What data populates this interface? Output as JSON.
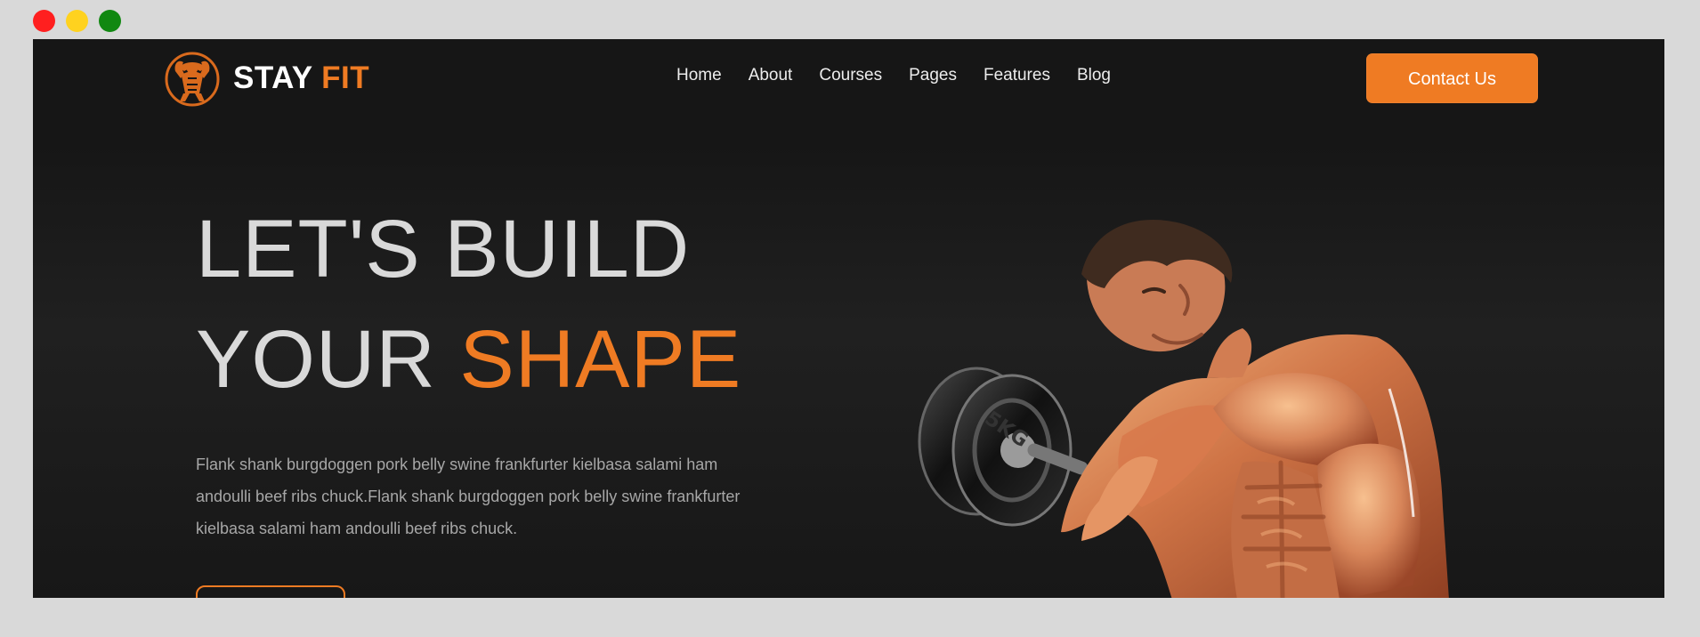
{
  "window_controls": {
    "red": "#ff1f1f",
    "yellow": "#ffd21f",
    "green": "#118811"
  },
  "brand": {
    "name_primary": "STAY",
    "name_accent": "FIT",
    "logo_icon": "bodybuilder-logo-icon",
    "accent_color": "#ef7b23"
  },
  "nav": {
    "items": [
      "Home",
      "About",
      "Courses",
      "Pages",
      "Features",
      "Blog"
    ],
    "cta_label": "Contact Us"
  },
  "hero": {
    "line_1": "LET'S BUILD",
    "line_2_prefix": "YOUR",
    "line_2_accent": "SHAPE",
    "description": "Flank shank burgdoggen pork belly swine frankfurter kielbasa salami ham andoulli beef ribs chuck.Flank shank burgdoggen pork belly swine frankfurter kielbasa salami ham andoulli beef ribs chuck.",
    "cta_label": "",
    "image_icon": "fitness-model-icon",
    "dumbbell_label": "5KG"
  }
}
